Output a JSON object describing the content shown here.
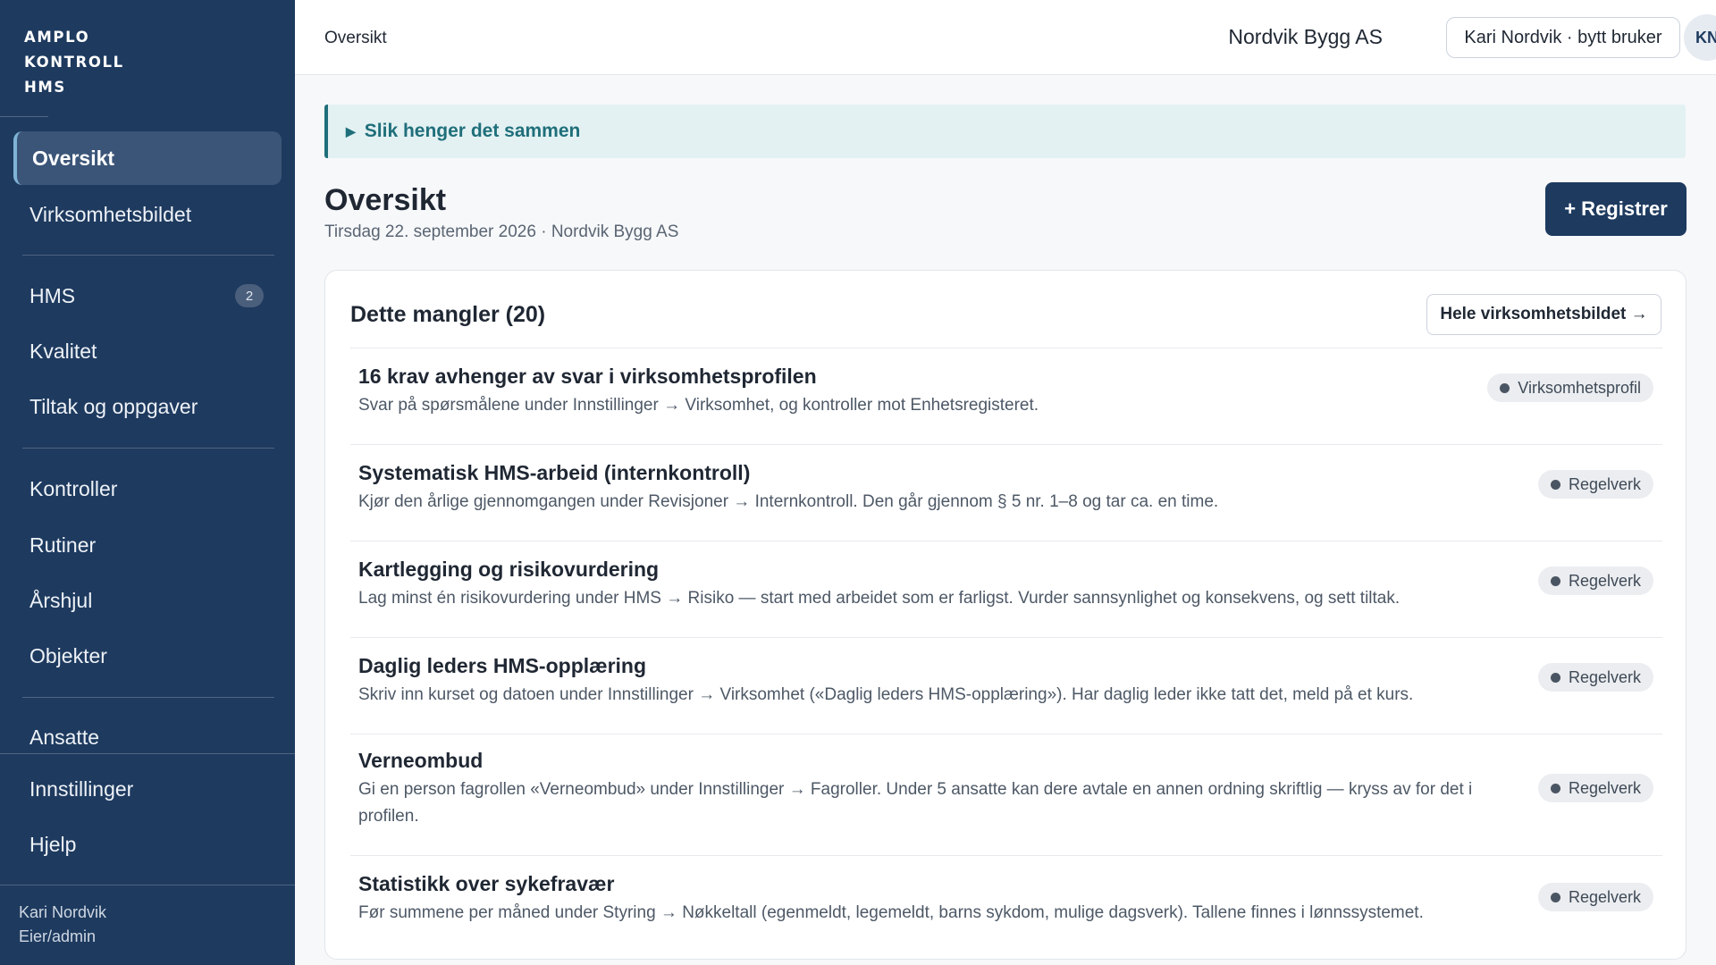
{
  "sidebar": {
    "logo": [
      "AMPLO",
      "KONTROLL",
      "HMS"
    ],
    "items": [
      {
        "label": "Oversikt"
      },
      {
        "label": "Virksomhetsbildet"
      },
      {
        "label": "HMS",
        "badge": "2"
      },
      {
        "label": "Kvalitet"
      },
      {
        "label": "Tiltak og oppgaver"
      },
      {
        "label": "Kontroller"
      },
      {
        "label": "Rutiner"
      },
      {
        "label": "Årshjul"
      },
      {
        "label": "Objekter"
      },
      {
        "label": "Ansatte"
      },
      {
        "label": "Innstillinger"
      },
      {
        "label": "Hjelp"
      }
    ],
    "user": {
      "name": "Kari Nordvik",
      "role": "Eier/admin"
    }
  },
  "topbar": {
    "breadcrumb": "Oversikt",
    "company": "Nordvik Bygg AS",
    "switch_user": "Kari Nordvik · bytt bruker",
    "avatar_initials": "KN"
  },
  "banner": {
    "label": "Slik henger det sammen",
    "icon": "triangle-right-icon"
  },
  "page": {
    "title": "Oversikt",
    "subtitle": "Tirsdag 22. september 2026 · Nordvik Bygg AS",
    "register_label": "+ Registrer"
  },
  "card": {
    "title": "Dette mangler (20)",
    "link_label": "Hele virksomhetsbildet →",
    "rows": [
      {
        "title": "16 krav avhenger av svar i virksomhetsprofilen",
        "desc": "Svar på spørsmålene under Innstillinger → Virksomhet, og kontroller mot Enhetsregisteret.",
        "tag": "Virksomhetsprofil"
      },
      {
        "title": "Systematisk HMS-arbeid (internkontroll)",
        "desc": "Kjør den årlige gjennomgangen under Revisjoner → Internkontroll. Den går gjennom § 5 nr. 1–8 og tar ca. en time.",
        "tag": "Regelverk"
      },
      {
        "title": "Kartlegging og risikovurdering",
        "desc": "Lag minst én risikovurdering under HMS → Risiko — start med arbeidet som er farligst. Vurder sannsynlighet og konsekvens, og sett tiltak.",
        "tag": "Regelverk"
      },
      {
        "title": "Daglig leders HMS-opplæring",
        "desc": "Skriv inn kurset og datoen under Innstillinger → Virksomhet («Daglig leders HMS-opplæring»). Har daglig leder ikke tatt det, meld på et kurs.",
        "tag": "Regelverk"
      },
      {
        "title": "Verneombud",
        "desc": "Gi en person fagrollen «Verneombud» under Innstillinger → Fagroller. Under 5 ansatte kan dere avtale en annen ordning skriftlig — kryss av for det i profilen.",
        "tag": "Regelverk"
      },
      {
        "title": "Statistikk over sykefravær",
        "desc": "Før summene per måned under Styring → Nøkkeltall (egenmeldt, legemeldt, barns sykdom, mulige dagsverk). Tallene finnes i lønnssystemet.",
        "tag": "Regelverk"
      }
    ]
  },
  "colors": {
    "sidebar_bg": "#1e3a5f",
    "accent": "#1f6f7a",
    "primary_button": "#1e3a5f"
  }
}
